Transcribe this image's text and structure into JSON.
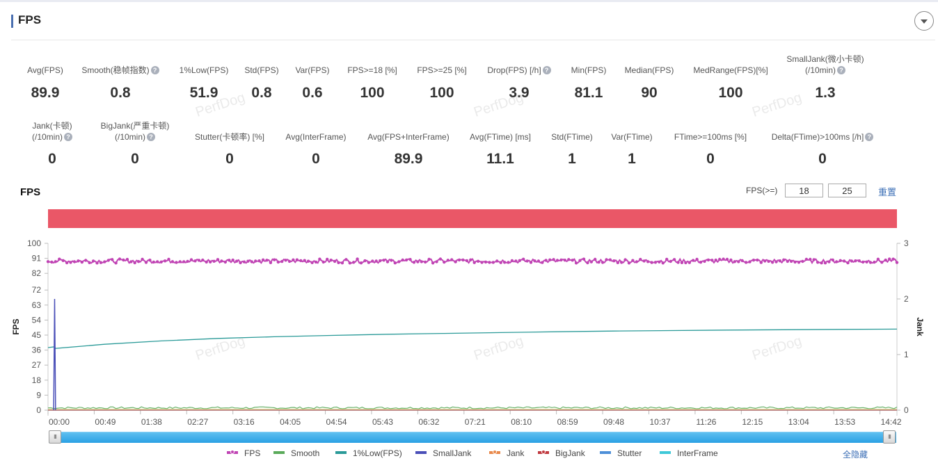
{
  "header": {
    "title": "FPS"
  },
  "metrics_row1": [
    {
      "label": "Avg(FPS)",
      "value": "89.9",
      "help": false
    },
    {
      "label": "Smooth(稳帧指数)",
      "value": "0.8",
      "help": true
    },
    {
      "label": "1%Low(FPS)",
      "value": "51.9",
      "help": false
    },
    {
      "label": "Std(FPS)",
      "value": "0.8",
      "help": false
    },
    {
      "label": "Var(FPS)",
      "value": "0.6",
      "help": false
    },
    {
      "label": "FPS>=18 [%]",
      "value": "100",
      "help": false
    },
    {
      "label": "FPS>=25 [%]",
      "value": "100",
      "help": false
    },
    {
      "label": "Drop(FPS) [/h]",
      "value": "3.9",
      "help": true
    },
    {
      "label": "Min(FPS)",
      "value": "81.1",
      "help": false
    },
    {
      "label": "Median(FPS)",
      "value": "90",
      "help": false
    },
    {
      "label": "MedRange(FPS)[%]",
      "value": "100",
      "help": false
    },
    {
      "label": "SmallJank(微小卡顿)",
      "label2": "(/10min)",
      "value": "1.3",
      "help": true
    }
  ],
  "metrics_row2": [
    {
      "label": "Jank(卡顿)",
      "label2": "(/10min)",
      "value": "0",
      "help": true
    },
    {
      "label": "BigJank(严重卡顿)",
      "label2": "(/10min)",
      "value": "0",
      "help": true
    },
    {
      "label": "Stutter(卡顿率) [%]",
      "value": "0",
      "help": false
    },
    {
      "label": "Avg(InterFrame)",
      "value": "0",
      "help": false
    },
    {
      "label": "Avg(FPS+InterFrame)",
      "value": "89.9",
      "help": false
    },
    {
      "label": "Avg(FTime) [ms]",
      "value": "11.1",
      "help": false
    },
    {
      "label": "Std(FTime)",
      "value": "1",
      "help": false
    },
    {
      "label": "Var(FTime)",
      "value": "1",
      "help": false
    },
    {
      "label": "FTime>=100ms [%]",
      "value": "0",
      "help": false
    },
    {
      "label": "Delta(FTime)>100ms [/h]",
      "value": "0",
      "help": true
    }
  ],
  "help_glyph": "?",
  "chart_section": {
    "title": "FPS",
    "filter_label": "FPS(>=)",
    "threshold_1": "18",
    "threshold_2": "25",
    "reset_label": "重置",
    "hide_all_label": "全隐藏",
    "handle_glyph": "III",
    "watermark": "PerfDog"
  },
  "colors": {
    "FPS": "#c044b4",
    "Smooth": "#5aaa5a",
    "1%Low(FPS)": "#2a9a98",
    "SmallJank": "#4a4fb8",
    "Jank": "#e8884a",
    "BigJank": "#c0393f",
    "Stutter": "#4d8fd8",
    "InterFrame": "#3ec8d8",
    "band": "#ea5767",
    "accent": "#3c6fb6"
  },
  "chart_data": {
    "type": "line",
    "title": "FPS",
    "xlabel": "",
    "ylabel": "FPS",
    "y2label": "Jank",
    "x_ticks": [
      "00:00",
      "00:49",
      "01:38",
      "02:27",
      "03:16",
      "04:05",
      "04:54",
      "05:43",
      "06:32",
      "07:21",
      "08:10",
      "08:59",
      "09:48",
      "10:37",
      "11:26",
      "12:15",
      "13:04",
      "13:53",
      "14:42"
    ],
    "y_ticks": [
      0,
      9,
      18,
      27,
      36,
      45,
      54,
      63,
      72,
      82,
      91,
      100
    ],
    "y2_ticks": [
      0,
      1,
      2,
      3
    ],
    "ylim": [
      0,
      100
    ],
    "y2lim": [
      0,
      3
    ],
    "xlim_seconds": [
      0,
      900
    ],
    "grid": false,
    "legend": "bottom",
    "series": [
      {
        "name": "FPS",
        "axis": "left",
        "marker": true,
        "typical": 90,
        "range": [
          87,
          91
        ],
        "min_point": {
          "t": 7,
          "v": 81.1
        }
      },
      {
        "name": "Smooth",
        "axis": "left",
        "marker": false,
        "typical": 0.8
      },
      {
        "name": "1%Low(FPS)",
        "axis": "left",
        "marker": false,
        "points": [
          [
            0,
            37.5
          ],
          [
            7,
            38
          ],
          [
            8,
            37
          ],
          [
            60,
            39.5
          ],
          [
            120,
            41.5
          ],
          [
            180,
            43
          ],
          [
            240,
            44
          ],
          [
            300,
            44.8
          ],
          [
            360,
            45.5
          ],
          [
            420,
            46
          ],
          [
            480,
            46.5
          ],
          [
            540,
            47
          ],
          [
            600,
            47.4
          ],
          [
            660,
            47.7
          ],
          [
            720,
            48
          ],
          [
            780,
            48.2
          ],
          [
            840,
            48.4
          ],
          [
            900,
            48.6
          ]
        ]
      },
      {
        "name": "SmallJank",
        "axis": "right",
        "marker": false,
        "spike": {
          "t": 7,
          "v": 2.0
        }
      },
      {
        "name": "Jank",
        "axis": "right",
        "marker": true,
        "typical": 0
      },
      {
        "name": "BigJank",
        "axis": "right",
        "marker": true,
        "typical": 0
      },
      {
        "name": "Stutter",
        "axis": "left",
        "marker": false,
        "typical": 0
      },
      {
        "name": "InterFrame",
        "axis": "left",
        "marker": false,
        "typical": 0
      }
    ]
  },
  "legend": [
    {
      "name": "FPS",
      "marker": true
    },
    {
      "name": "Smooth",
      "marker": false
    },
    {
      "name": "1%Low(FPS)",
      "marker": false
    },
    {
      "name": "SmallJank",
      "marker": false
    },
    {
      "name": "Jank",
      "marker": true
    },
    {
      "name": "BigJank",
      "marker": true
    },
    {
      "name": "Stutter",
      "marker": false
    },
    {
      "name": "InterFrame",
      "marker": false
    }
  ]
}
